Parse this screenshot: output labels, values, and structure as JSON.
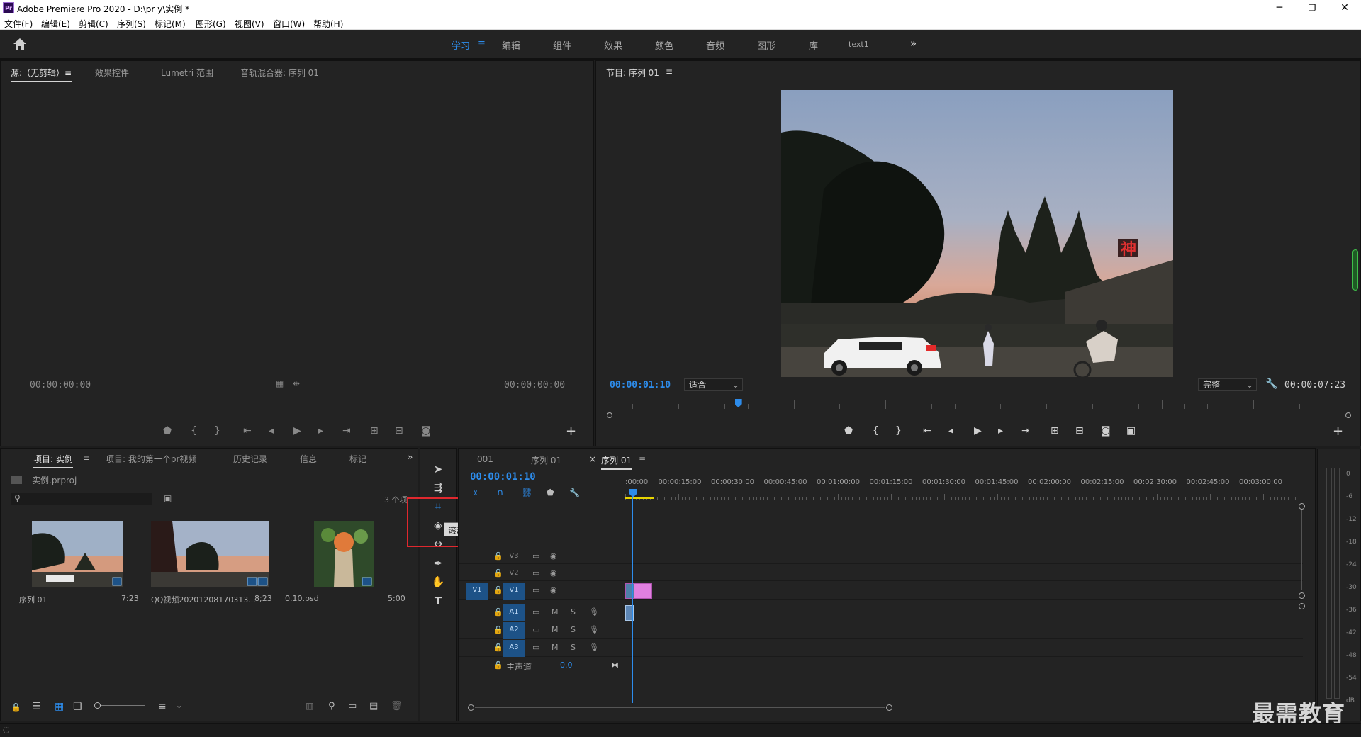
{
  "window": {
    "title": "Adobe Premiere Pro 2020 - D:\\pr y\\实例 *",
    "app_icon": "Pr",
    "minimize": "─",
    "restore": "❐",
    "close": "✕"
  },
  "menu": [
    "文件(F)",
    "编辑(E)",
    "剪辑(C)",
    "序列(S)",
    "标记(M)",
    "图形(G)",
    "视图(V)",
    "窗口(W)",
    "帮助(H)"
  ],
  "workspaces": {
    "tabs": [
      "学习",
      "编辑",
      "组件",
      "效果",
      "颜色",
      "音频",
      "图形",
      "库",
      "text1"
    ],
    "active": "学习",
    "active_menu": "≡",
    "more": "»"
  },
  "source_panel": {
    "tabs": [
      "源:（无剪辑）≡",
      "效果控件",
      "Lumetri 范围",
      "音轨混合器: 序列 01"
    ],
    "timecode_left": "00:00:00:00",
    "timecode_right": "00:00:00:00"
  },
  "program_panel": {
    "tab": "节目: 序列 01",
    "tab_menu": "≡",
    "timecode": "00:00:01:10",
    "fit": "适合",
    "quality": "完整",
    "duration": "00:00:07:23",
    "playhead_fraction": 0.175,
    "video_sign": "神"
  },
  "project_panel": {
    "tabs": [
      "项目: 实例",
      "项目: 我的第一个pr视频",
      "历史记录",
      "信息",
      "标记"
    ],
    "tab_menu": "≡",
    "more": "»",
    "project_file": "实例.prproj",
    "item_count": "3 个项",
    "items": [
      {
        "name": "序列 01",
        "duration": "7:23"
      },
      {
        "name": "QQ视频20201208170313...",
        "duration": "8;23"
      },
      {
        "name": "0.10.psd",
        "duration": "5:00"
      }
    ]
  },
  "tools": {
    "tooltip": "滚动编辑工具 (N)"
  },
  "timeline": {
    "tabs": [
      "001",
      "序列 01",
      "序列 01"
    ],
    "tab_close": "×",
    "tab_menu": "≡",
    "timecode": "00:00:01:10",
    "ruler": [
      ":00:00",
      "00:00:15:00",
      "00:00:30:00",
      "00:00:45:00",
      "00:01:00:00",
      "00:01:15:00",
      "00:01:30:00",
      "00:01:45:00",
      "00:02:00:00",
      "00:02:15:00",
      "00:02:30:00",
      "00:02:45:00",
      "00:03:00:00"
    ],
    "video_tracks": [
      "V3",
      "V2",
      "V1"
    ],
    "source_patch": "V1",
    "audio_tracks": [
      "A1",
      "A2",
      "A3"
    ],
    "mute": "M",
    "solo": "S",
    "master_label": "主声道",
    "master_value": "0.0"
  },
  "meter": {
    "db_labels": [
      "0",
      "-6",
      "-12",
      "-18",
      "-24",
      "-30",
      "-36",
      "-42",
      "-48",
      "-54",
      "dB"
    ]
  },
  "watermark": "最需教育",
  "colors": {
    "accent": "#2d8ceb",
    "highlight_box": "#e0282e",
    "clip_pink": "#e07fe0",
    "track_blue": "#1d5287"
  }
}
